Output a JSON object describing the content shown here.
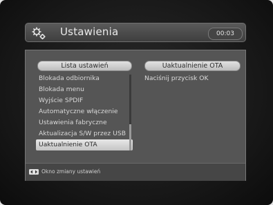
{
  "header": {
    "title": "Ustawienia",
    "clock": "00:03"
  },
  "left_panel": {
    "title": "Lista ustawień",
    "items": [
      {
        "label": "Blokada odbiornika"
      },
      {
        "label": "Blokada menu"
      },
      {
        "label": "Wyjście SPDIF"
      },
      {
        "label": "Automatyczne włączenie"
      },
      {
        "label": "Ustawienia fabryczne"
      },
      {
        "label": "Aktualizacja S/W przez USB"
      },
      {
        "label": "Uaktualnienie OTA"
      }
    ],
    "selected_label": "Uaktualnienie OTA"
  },
  "right_panel": {
    "title": "Uaktualnienie OTA",
    "text": "Naciśnij przycisk OK"
  },
  "footer": {
    "icon": "arrows-left-right-icon",
    "text": "Okno zmiany ustawień"
  },
  "colors": {
    "background": "#161616",
    "panel": "#555555",
    "header": "#4a4a4a",
    "highlight": "#d6d6d6"
  }
}
